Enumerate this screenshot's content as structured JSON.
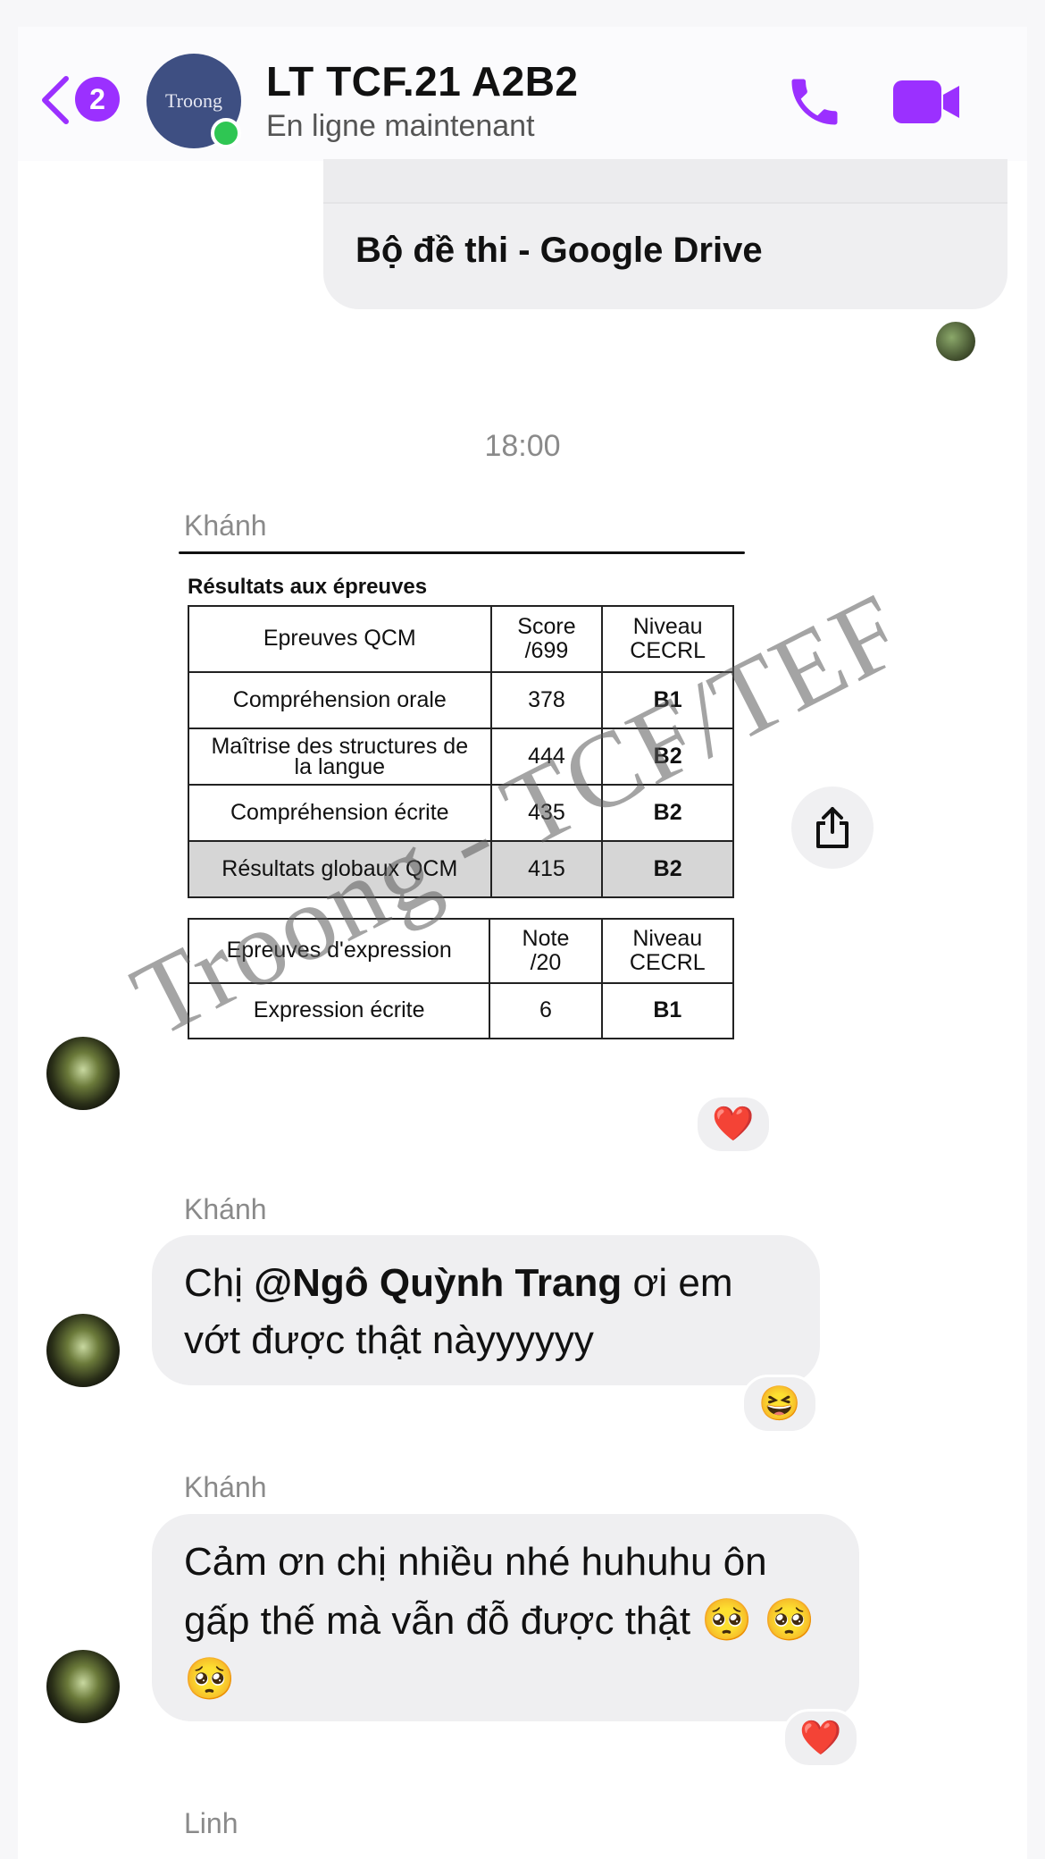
{
  "header": {
    "unread_count": "2",
    "avatar_text": "Troong",
    "title": "LT TCF.21 A2B2",
    "status": "En ligne maintenant"
  },
  "link_card": {
    "title": "Bộ đề thi - Google Drive"
  },
  "timestamp": "18:00",
  "messages": [
    {
      "sender": "Khánh",
      "type": "image",
      "image": {
        "heading": "Résultats aux épreuves",
        "table1": {
          "headers": [
            "Epreuves QCM",
            "Score /699",
            "Niveau CECRL"
          ],
          "rows": [
            [
              "Compréhension orale",
              "378",
              "B1"
            ],
            [
              "Maîtrise des structures de la langue",
              "444",
              "B2"
            ],
            [
              "Compréhension écrite",
              "435",
              "B2"
            ],
            [
              "Résultats globaux QCM",
              "415",
              "B2"
            ]
          ]
        },
        "table2": {
          "headers": [
            "Epreuves d'expression",
            "Note /20",
            "Niveau CECRL"
          ],
          "rows": [
            [
              "Expression écrite",
              "6",
              "B1"
            ]
          ]
        },
        "watermark": "Troong - TCF/TEF"
      },
      "reaction": "❤️"
    },
    {
      "sender": "Khánh",
      "type": "text",
      "prefix": "Chị ",
      "mention": "@Ngô Quỳnh Trang",
      "suffix": " ơi em vớt được thật nàyyyyyy",
      "reaction": "😆"
    },
    {
      "sender": "Khánh",
      "type": "text",
      "text": "Cảm ơn chị nhiều nhé huhuhu ôn gấp thế mà vẫn đỗ được thật",
      "emojis": "🥺 🥺 🥺",
      "reaction": "❤️"
    },
    {
      "sender": "Linh",
      "type": "partial"
    }
  ],
  "colors": {
    "accent": "#9b30ff",
    "bubble": "#efeff1",
    "online": "#2fc653"
  },
  "icons": [
    "back-chevron-icon",
    "phone-icon",
    "video-camera-icon",
    "share-icon",
    "heart-reaction",
    "laugh-reaction"
  ]
}
